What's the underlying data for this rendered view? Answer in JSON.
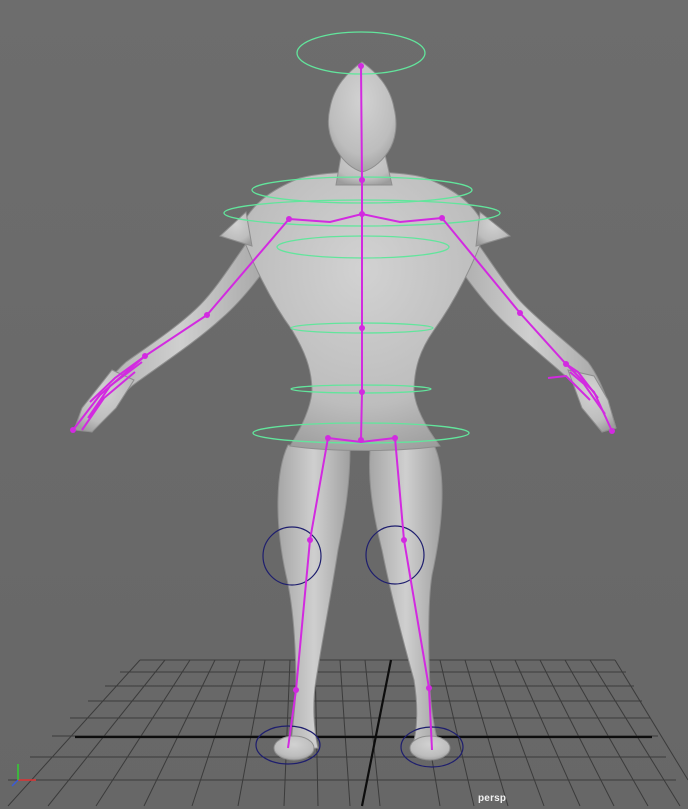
{
  "viewport": {
    "camera_label": "persp",
    "view_type": "perspective"
  },
  "colors": {
    "background": "#6a6a6a",
    "grid": "#3b3b3b",
    "grid_axis": "#0d0d0d",
    "mesh": "#c4c4c4",
    "joints": "#d22ae0",
    "fk_controls": "#62e59c",
    "ik_controls": "#1e1e6e",
    "axis_x": "#e03030",
    "axis_y": "#30d030",
    "axis_z": "#3a5ad8"
  },
  "icons": {
    "axis": "axis-gizmo-icon"
  }
}
